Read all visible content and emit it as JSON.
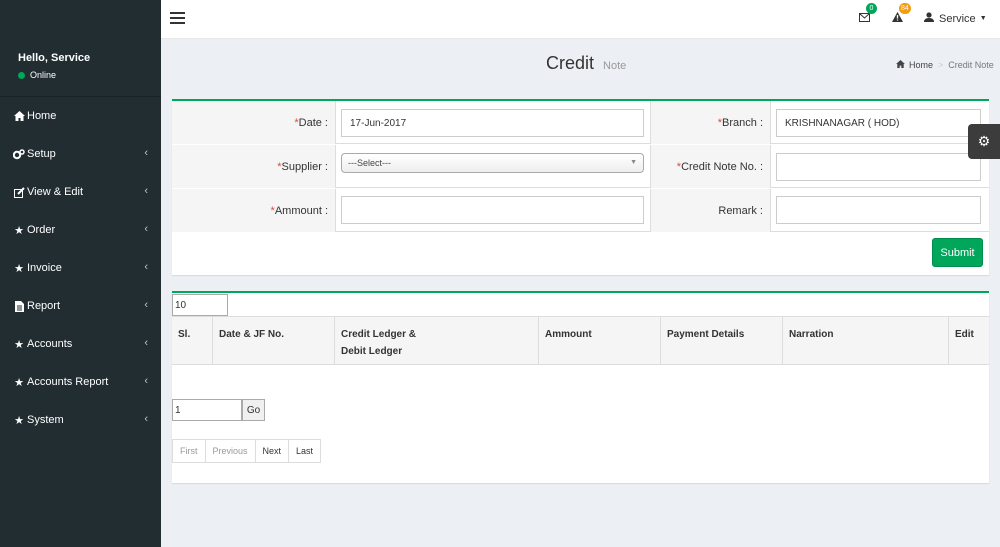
{
  "sidebar": {
    "greeting": "Hello, Service",
    "status": "Online",
    "items": [
      {
        "label": "Home",
        "icon": "home-icon",
        "has_children": false
      },
      {
        "label": "Setup",
        "icon": "cogs-icon",
        "has_children": true
      },
      {
        "label": "View & Edit",
        "icon": "edit-icon",
        "has_children": true
      },
      {
        "label": "Order",
        "icon": "star-icon",
        "has_children": true
      },
      {
        "label": "Invoice",
        "icon": "star-icon",
        "has_children": true
      },
      {
        "label": "Report",
        "icon": "file-icon",
        "has_children": true
      },
      {
        "label": "Accounts",
        "icon": "star-icon",
        "has_children": true
      },
      {
        "label": "Accounts Report",
        "icon": "star-icon",
        "has_children": true
      },
      {
        "label": "System",
        "icon": "star-icon",
        "has_children": true
      }
    ]
  },
  "topbar": {
    "mail_count": "0",
    "alert_count": "84",
    "user_label": "Service"
  },
  "header": {
    "title": "Credit",
    "subtitle": "Note",
    "breadcrumb_home": "Home",
    "breadcrumb_current": "Credit Note"
  },
  "form": {
    "date_label": "Date :",
    "date_value": "17-Jun-2017",
    "branch_label": "Branch :",
    "branch_value": "KRISHNANAGAR ( HOD)",
    "supplier_label": "Supplier :",
    "supplier_value": "---Select---",
    "credit_note_label": "Credit Note No. :",
    "credit_note_value": "",
    "amount_label": "Ammount :",
    "amount_value": "",
    "remark_label": "Remark :",
    "remark_value": "",
    "submit_label": "Submit"
  },
  "table": {
    "page_size": "10",
    "columns": [
      "Sl.",
      "Date & JF No.",
      "Credit Ledger &",
      "Debit Ledger",
      "Ammount",
      "Payment Details",
      "Narration",
      "Edit"
    ],
    "page_number": "1",
    "go_label": "Go",
    "pager": [
      "First",
      "Previous",
      "Next",
      "Last"
    ]
  },
  "colors": {
    "sidebar_bg": "#222d32",
    "accent_green": "#00a65a",
    "required_red": "#dd4b39",
    "badge_orange": "#f39c12"
  }
}
